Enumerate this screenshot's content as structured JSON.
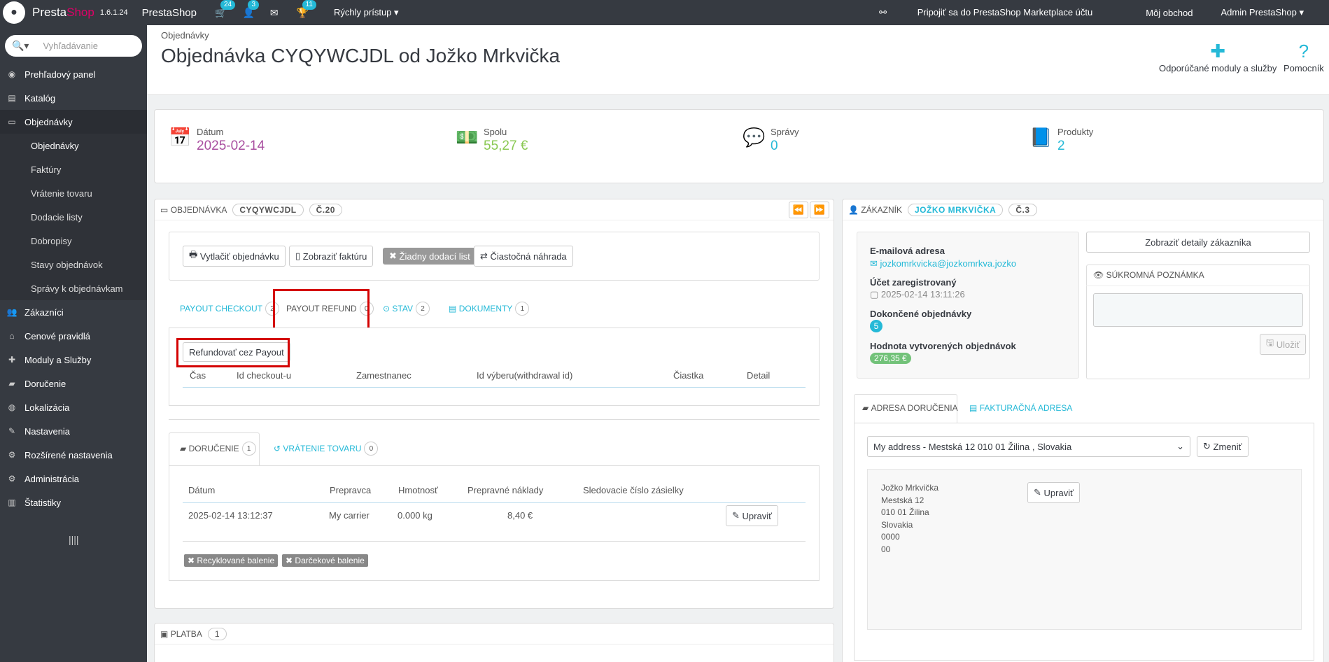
{
  "topbar": {
    "brand_a": "Presta",
    "brand_b": "Shop",
    "version": "1.6.1.24",
    "shop_name": "PrestaShop",
    "badge_orders": "24",
    "badge_customers": "3",
    "badge_trophy": "11",
    "quick_access": "Rýchly prístup ▾",
    "marketplace": "Pripojiť sa do PrestaShop Marketplace účtu",
    "my_shop": "Môj obchod",
    "admin": "Admin PrestaShop ▾"
  },
  "sidebar": {
    "search_placeholder": "Vyhľadávanie",
    "items": [
      {
        "label": "Prehľadový panel",
        "icon": "dashboard-icon"
      },
      {
        "label": "Katalóg",
        "icon": "book-icon"
      },
      {
        "label": "Objednávky",
        "icon": "credit-card-icon"
      },
      {
        "label": "Zákazníci",
        "icon": "users-icon"
      },
      {
        "label": "Cenové pravidlá",
        "icon": "tags-icon"
      },
      {
        "label": "Moduly a Služby",
        "icon": "puzzle-icon"
      },
      {
        "label": "Doručenie",
        "icon": "truck-icon"
      },
      {
        "label": "Lokalizácia",
        "icon": "globe-icon"
      },
      {
        "label": "Nastavenia",
        "icon": "wrench-icon"
      },
      {
        "label": "Rozšírené nastavenia",
        "icon": "cogs-icon"
      },
      {
        "label": "Administrácia",
        "icon": "cog-icon"
      },
      {
        "label": "Štatistiky",
        "icon": "bar-chart-icon"
      }
    ],
    "subitems": [
      "Objednávky",
      "Faktúry",
      "Vrátenie tovaru",
      "Dodacie listy",
      "Dobropisy",
      "Stavy objednávok",
      "Správy k objednávkam"
    ],
    "collapse_glyph": "||||"
  },
  "header": {
    "breadcrumb": "Objednávky",
    "title": "Objednávka CYQYWCJDL od Jožko Mrkvička",
    "recommended": "Odporúčané moduly a služby",
    "help": "Pomocník"
  },
  "kpis": [
    {
      "label": "Dátum",
      "value": "2025-02-14",
      "color": "#a94fa0"
    },
    {
      "label": "Spolu",
      "value": "55,27 €",
      "color": "#8bc954"
    },
    {
      "label": "Správy",
      "value": "0",
      "color": "#e74c3c"
    },
    {
      "label": "Produkty",
      "value": "2",
      "color": "#25b9d7"
    }
  ],
  "order": {
    "header_label": "OBJEDNÁVKA",
    "reference": "CYQYWCJDL",
    "number": "Č.20",
    "buttons": {
      "print": "Vytlačiť objednávku",
      "invoice": "Zobraziť faktúru",
      "no_delivery": "Žiadny dodací list",
      "partial_refund": "Čiastočná náhrada"
    },
    "tabs": [
      {
        "label": "PAYOUT CHECKOUT",
        "count": "2"
      },
      {
        "label": "PAYOUT REFUND",
        "count": "0"
      },
      {
        "label": "STAV",
        "count": "2"
      },
      {
        "label": "DOKUMENTY",
        "count": "1"
      }
    ],
    "refund_button": "Refundovať cez Payout",
    "refund_columns": [
      "Čas",
      "Id checkout-u",
      "Zamestnanec",
      "Id výberu(withdrawal id)",
      "Čiastka",
      "Detail"
    ],
    "shipping_tabs": [
      {
        "label": "DORUČENIE",
        "count": "1"
      },
      {
        "label": "VRÁTENIE TOVARU",
        "count": "0"
      }
    ],
    "shipping_columns": [
      "Dátum",
      "Prepravca",
      "Hmotnosť",
      "Prepravné náklady",
      "Sledovacie číslo zásielky"
    ],
    "shipping_row": {
      "date": "2025-02-14 13:12:37",
      "carrier": "My carrier",
      "weight": "0.000 kg",
      "cost": "8,40 €",
      "edit": "Upraviť"
    },
    "recycled": "Recyklované balenie",
    "gift": "Darčekové balenie",
    "payment_label": "PLATBA",
    "payment_count": "1"
  },
  "customer": {
    "header_label": "ZÁKAZNÍK",
    "name_tag": "JOŽKO MRKVIČKA",
    "number": "Č.3",
    "email_label": "E-mailová adresa",
    "email": "jozkomrkvicka@jozkomrkva.jozko",
    "registered_label": "Účet zaregistrovaný",
    "registered": "2025-02-14 13:11:26",
    "completed_label": "Dokončené objednávky",
    "completed": "5",
    "value_label": "Hodnota vytvorených objednávok",
    "value": "276,35 €",
    "details_button": "Zobraziť detaily zákazníka",
    "private_note": "SÚKROMNÁ POZNÁMKA",
    "save": "Uložiť",
    "address_tabs": [
      "ADRESA DORUČENIA",
      "FAKTURAČNÁ ADRESA"
    ],
    "address_select": "My address - Mestská 12 010 01 Žilina , Slovakia",
    "change": "Zmeniť",
    "edit": "Upraviť",
    "address_lines": [
      "Jožko Mrkvička",
      "Mestská 12",
      "010 01 Žilina",
      "Slovakia",
      "0000",
      "00"
    ]
  }
}
